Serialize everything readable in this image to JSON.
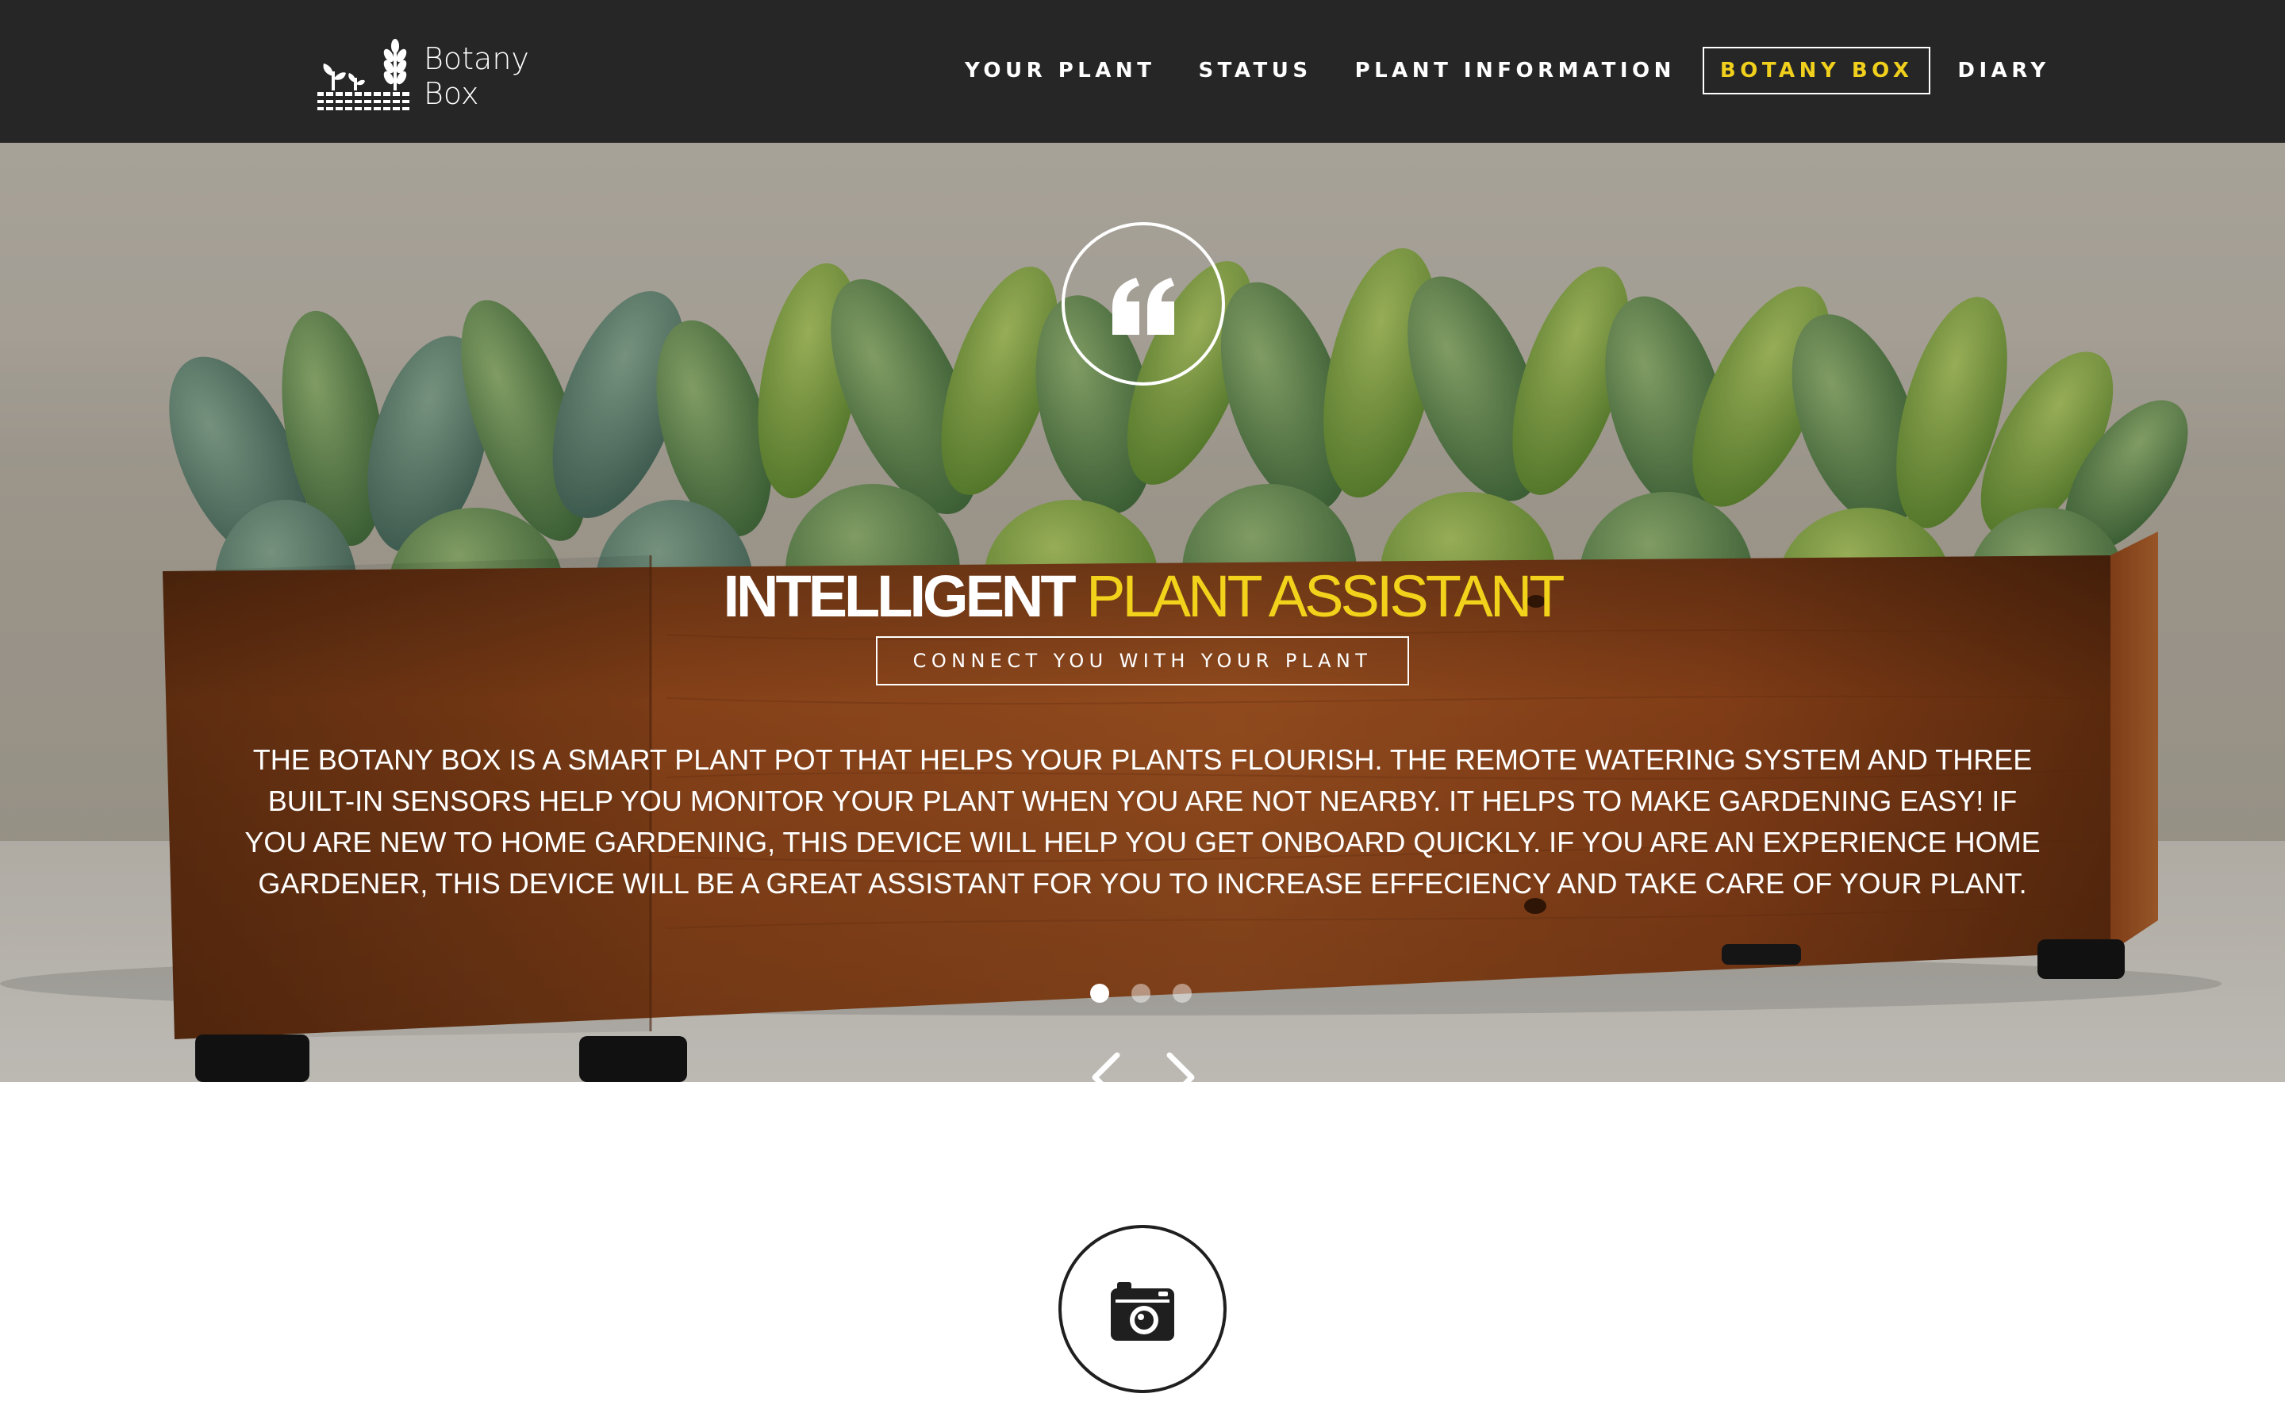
{
  "brand": {
    "line1": "Botany",
    "line2": "Box"
  },
  "nav": {
    "items": [
      {
        "label": "YOUR PLANT"
      },
      {
        "label": "STATUS"
      },
      {
        "label": "PLANT INFORMATION"
      },
      {
        "label": "BOTANY BOX",
        "active": true
      },
      {
        "label": "DIARY"
      }
    ]
  },
  "hero": {
    "title_bold": "INTELLIGENT",
    "title_accent": "PLANT ASSISTANT",
    "tagline": "CONNECT YOU WITH YOUR PLANT",
    "description": "The Botany Box is a smart plant pot that helps your plants flourish. The remote watering system and three built-in sensors help you monitor your plant when you are not nearby. It helps to make gardening easy! If you are new to home gardening, this device will help you get onboard quickly. If you are an experience home gardener, this device will be a great assistant for you to increase effeciency and take care of your plant.",
    "slides": 3,
    "active_slide": 1
  },
  "icons": {
    "quote": "quote-icon",
    "camera": "camera-icon",
    "prev": "chevron-left-icon",
    "next": "chevron-right-icon"
  },
  "colors": {
    "nav_bg": "#262626",
    "accent": "#f2d21b",
    "text": "#ffffff",
    "planter_wood": "#a7521f"
  }
}
